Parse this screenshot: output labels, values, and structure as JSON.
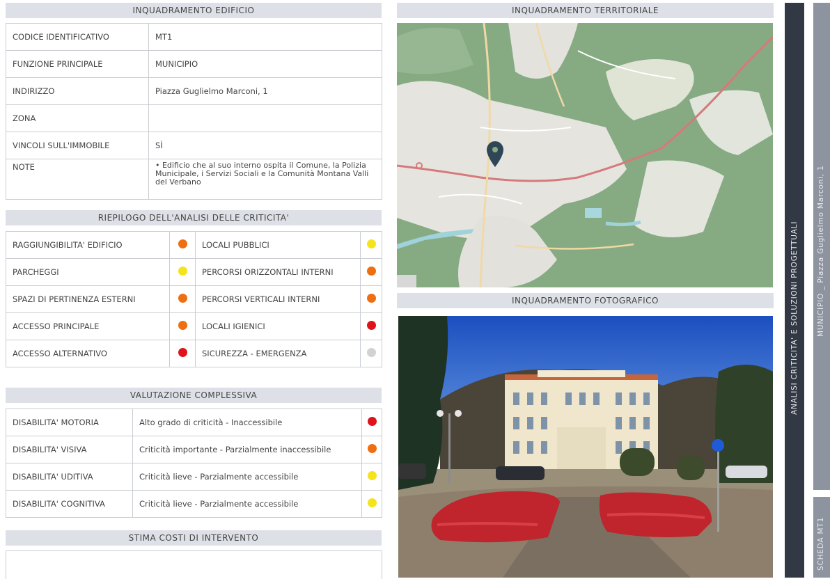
{
  "edificio": {
    "header": "INQUADRAMENTO EDIFICIO",
    "rows": [
      {
        "label": "CODICE IDENTIFICATIVO",
        "value": "MT1"
      },
      {
        "label": "FUNZIONE PRINCIPALE",
        "value": "MUNICIPIO"
      },
      {
        "label": "INDIRIZZO",
        "value": "Piazza Guglielmo Marconi, 1"
      },
      {
        "label": "ZONA",
        "value": ""
      },
      {
        "label": "VINCOLI SULL'IMMOBILE",
        "value": "SÌ"
      },
      {
        "label": "NOTE",
        "value": "• Edificio che al suo interno ospita il Comune, la Polizia Municipale, i Servizi Sociali e la Comunità Montana Valli del Verbano"
      }
    ]
  },
  "riepilogo": {
    "header": "RIEPILOGO DELL'ANALISI DELLE CRITICITA'",
    "rows": [
      {
        "left_label": "RAGGIUNGIBILITA' EDIFICIO",
        "left_color": "#ee6e12",
        "right_label": "LOCALI PUBBLICI",
        "right_color": "#f5e31c"
      },
      {
        "left_label": "PARCHEGGI",
        "left_color": "#f5e31c",
        "right_label": "PERCORSI ORIZZONTALI INTERNI",
        "right_color": "#ee6e12"
      },
      {
        "left_label": "SPAZI DI PERTINENZA ESTERNI",
        "left_color": "#ee6e12",
        "right_label": "PERCORSI VERTICALI INTERNI",
        "right_color": "#ee6e12"
      },
      {
        "left_label": "ACCESSO PRINCIPALE",
        "left_color": "#ee6e12",
        "right_label": "LOCALI IGIENICI",
        "right_color": "#e0131a"
      },
      {
        "left_label": "ACCESSO ALTERNATIVO",
        "left_color": "#e0131a",
        "right_label": "SICUREZZA - EMERGENZA",
        "right_color": "#d0d2d4"
      }
    ]
  },
  "valutazione": {
    "header": "VALUTAZIONE COMPLESSIVA",
    "rows": [
      {
        "label": "DISABILITA' MOTORIA",
        "value": "Alto grado di criticità - Inaccessibile",
        "color": "#e0131a"
      },
      {
        "label": "DISABILITA' VISIVA",
        "value": "Criticità importante - Parzialmente inaccessibile",
        "color": "#ee6e12"
      },
      {
        "label": "DISABILITA' UDITIVA",
        "value": "Criticità lieve - Parzialmente accessibile",
        "color": "#f5e31c"
      },
      {
        "label": "DISABILITA' COGNITIVA",
        "value": "Criticità lieve - Parzialmente accessibile",
        "color": "#f5e31c"
      }
    ]
  },
  "costi": {
    "header": "STIMA COSTI DI INTERVENTO",
    "value": ""
  },
  "territoriale": {
    "header": "INQUADRAMENTO TERRITORIALE"
  },
  "fotografico": {
    "header": "INQUADRAMENTO FOTOGRAFICO"
  },
  "sidebar": {
    "section": "ANALISI CRITICITA' E SOLUZIONI PROGETTUALI",
    "building": "MUNICIPIO _ Piazza Guglielmo Marconi, 1",
    "scheda": "SCHEDA MT1"
  },
  "colors": {
    "red": "#e0131a",
    "orange": "#ee6e12",
    "yellow": "#f5e31c",
    "grey": "#d0d2d4"
  }
}
